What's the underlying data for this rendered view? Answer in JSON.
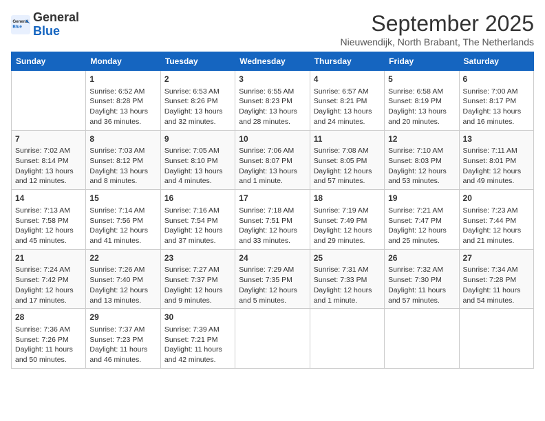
{
  "header": {
    "logo_general": "General",
    "logo_blue": "Blue",
    "month": "September 2025",
    "location": "Nieuwendijk, North Brabant, The Netherlands"
  },
  "days_of_week": [
    "Sunday",
    "Monday",
    "Tuesday",
    "Wednesday",
    "Thursday",
    "Friday",
    "Saturday"
  ],
  "weeks": [
    [
      {
        "day": "",
        "info": ""
      },
      {
        "day": "1",
        "info": "Sunrise: 6:52 AM\nSunset: 8:28 PM\nDaylight: 13 hours and 36 minutes."
      },
      {
        "day": "2",
        "info": "Sunrise: 6:53 AM\nSunset: 8:26 PM\nDaylight: 13 hours and 32 minutes."
      },
      {
        "day": "3",
        "info": "Sunrise: 6:55 AM\nSunset: 8:23 PM\nDaylight: 13 hours and 28 minutes."
      },
      {
        "day": "4",
        "info": "Sunrise: 6:57 AM\nSunset: 8:21 PM\nDaylight: 13 hours and 24 minutes."
      },
      {
        "day": "5",
        "info": "Sunrise: 6:58 AM\nSunset: 8:19 PM\nDaylight: 13 hours and 20 minutes."
      },
      {
        "day": "6",
        "info": "Sunrise: 7:00 AM\nSunset: 8:17 PM\nDaylight: 13 hours and 16 minutes."
      }
    ],
    [
      {
        "day": "7",
        "info": "Sunrise: 7:02 AM\nSunset: 8:14 PM\nDaylight: 13 hours and 12 minutes."
      },
      {
        "day": "8",
        "info": "Sunrise: 7:03 AM\nSunset: 8:12 PM\nDaylight: 13 hours and 8 minutes."
      },
      {
        "day": "9",
        "info": "Sunrise: 7:05 AM\nSunset: 8:10 PM\nDaylight: 13 hours and 4 minutes."
      },
      {
        "day": "10",
        "info": "Sunrise: 7:06 AM\nSunset: 8:07 PM\nDaylight: 13 hours and 1 minute."
      },
      {
        "day": "11",
        "info": "Sunrise: 7:08 AM\nSunset: 8:05 PM\nDaylight: 12 hours and 57 minutes."
      },
      {
        "day": "12",
        "info": "Sunrise: 7:10 AM\nSunset: 8:03 PM\nDaylight: 12 hours and 53 minutes."
      },
      {
        "day": "13",
        "info": "Sunrise: 7:11 AM\nSunset: 8:01 PM\nDaylight: 12 hours and 49 minutes."
      }
    ],
    [
      {
        "day": "14",
        "info": "Sunrise: 7:13 AM\nSunset: 7:58 PM\nDaylight: 12 hours and 45 minutes."
      },
      {
        "day": "15",
        "info": "Sunrise: 7:14 AM\nSunset: 7:56 PM\nDaylight: 12 hours and 41 minutes."
      },
      {
        "day": "16",
        "info": "Sunrise: 7:16 AM\nSunset: 7:54 PM\nDaylight: 12 hours and 37 minutes."
      },
      {
        "day": "17",
        "info": "Sunrise: 7:18 AM\nSunset: 7:51 PM\nDaylight: 12 hours and 33 minutes."
      },
      {
        "day": "18",
        "info": "Sunrise: 7:19 AM\nSunset: 7:49 PM\nDaylight: 12 hours and 29 minutes."
      },
      {
        "day": "19",
        "info": "Sunrise: 7:21 AM\nSunset: 7:47 PM\nDaylight: 12 hours and 25 minutes."
      },
      {
        "day": "20",
        "info": "Sunrise: 7:23 AM\nSunset: 7:44 PM\nDaylight: 12 hours and 21 minutes."
      }
    ],
    [
      {
        "day": "21",
        "info": "Sunrise: 7:24 AM\nSunset: 7:42 PM\nDaylight: 12 hours and 17 minutes."
      },
      {
        "day": "22",
        "info": "Sunrise: 7:26 AM\nSunset: 7:40 PM\nDaylight: 12 hours and 13 minutes."
      },
      {
        "day": "23",
        "info": "Sunrise: 7:27 AM\nSunset: 7:37 PM\nDaylight: 12 hours and 9 minutes."
      },
      {
        "day": "24",
        "info": "Sunrise: 7:29 AM\nSunset: 7:35 PM\nDaylight: 12 hours and 5 minutes."
      },
      {
        "day": "25",
        "info": "Sunrise: 7:31 AM\nSunset: 7:33 PM\nDaylight: 12 hours and 1 minute."
      },
      {
        "day": "26",
        "info": "Sunrise: 7:32 AM\nSunset: 7:30 PM\nDaylight: 11 hours and 57 minutes."
      },
      {
        "day": "27",
        "info": "Sunrise: 7:34 AM\nSunset: 7:28 PM\nDaylight: 11 hours and 54 minutes."
      }
    ],
    [
      {
        "day": "28",
        "info": "Sunrise: 7:36 AM\nSunset: 7:26 PM\nDaylight: 11 hours and 50 minutes."
      },
      {
        "day": "29",
        "info": "Sunrise: 7:37 AM\nSunset: 7:23 PM\nDaylight: 11 hours and 46 minutes."
      },
      {
        "day": "30",
        "info": "Sunrise: 7:39 AM\nSunset: 7:21 PM\nDaylight: 11 hours and 42 minutes."
      },
      {
        "day": "",
        "info": ""
      },
      {
        "day": "",
        "info": ""
      },
      {
        "day": "",
        "info": ""
      },
      {
        "day": "",
        "info": ""
      }
    ]
  ]
}
